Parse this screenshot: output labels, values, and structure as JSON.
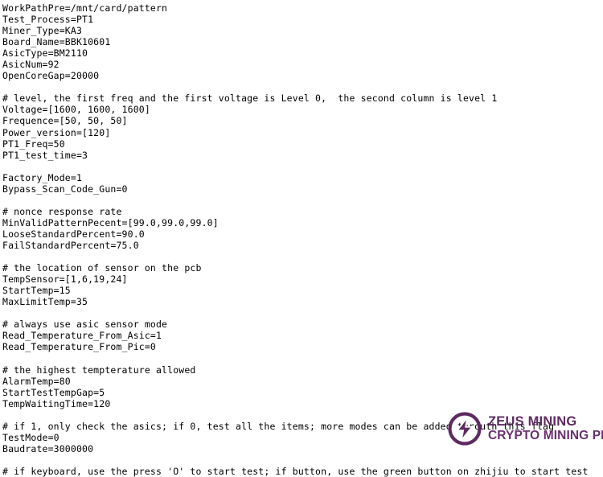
{
  "document": {
    "type": "plain-text-config-file",
    "font_color": "#000000",
    "background_color": "#ffffff",
    "lines": [
      "WorkPathPre=/mnt/card/pattern",
      "Test_Process=PT1",
      "Miner_Type=KA3",
      "Board_Name=BBK10601",
      "AsicType=BM2110",
      "AsicNum=92",
      "OpenCoreGap=20000",
      "",
      "# level, the first freq and the first voltage is Level 0,  the second column is level 1",
      "Voltage=[1600, 1600, 1600]",
      "Frequence=[50, 50, 50]",
      "Power_version=[120]",
      "PT1_Freq=50",
      "PT1_test_time=3",
      "",
      "Factory_Mode=1",
      "Bypass_Scan_Code_Gun=0",
      "",
      "# nonce response rate",
      "MinValidPatternPecent=[99.0,99.0,99.0]",
      "LooseStandardPercent=90.0",
      "FailStandardPercent=75.0",
      "",
      "# the location of sensor on the pcb",
      "TempSensor=[1,6,19,24]",
      "StartTemp=15",
      "MaxLimitTemp=35",
      "",
      "# always use asic sensor mode",
      "Read_Temperature_From_Asic=1",
      "Read_Temperature_From_Pic=0",
      "",
      "# the highest tempterature allowed",
      "AlarmTemp=80",
      "StartTestTempGap=5",
      "TempWaitingTime=120",
      "",
      "# if 1, only check the asics; if 0, test all the items; more modes can be added throuth this flag",
      "TestMode=0",
      "Baudrate=3000000",
      "",
      "# if keyboard, use the press 'O' to start test; if button, use the green button on zhijiu to start test"
    ]
  },
  "watermark": {
    "logo_icon": "lightning-bolt-circle-icon",
    "line1": "ZEUS MINING",
    "line2": "CRYPTO MINING PRO",
    "color": "#5d2a62"
  }
}
